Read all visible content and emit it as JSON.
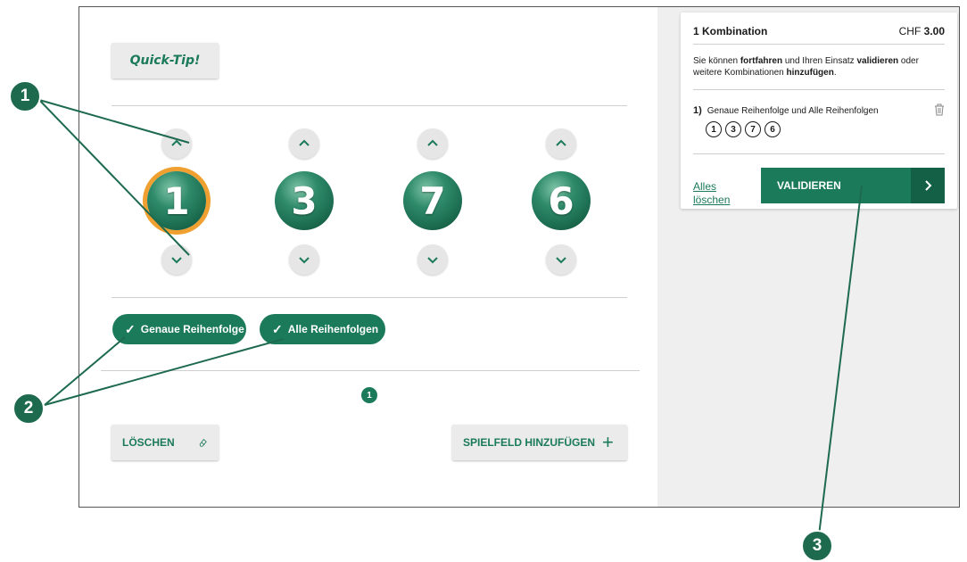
{
  "quick_tip": {
    "label": "Quick-Tip!"
  },
  "balls": [
    {
      "number": "1",
      "selected": true
    },
    {
      "number": "3",
      "selected": false
    },
    {
      "number": "7",
      "selected": false
    },
    {
      "number": "6",
      "selected": false
    }
  ],
  "options": [
    {
      "label": "Genaue Reihenfolge"
    },
    {
      "label": "Alle Reihenfolgen"
    }
  ],
  "pagination": {
    "current": "1"
  },
  "actions": {
    "delete_label": "LÖSCHEN",
    "add_field_label": "SPIELFELD HINZUFÜGEN"
  },
  "summary": {
    "title": "1 Kombination",
    "currency": "CHF",
    "amount": "3.00",
    "msg_1": "Sie können ",
    "msg_b1": "fortfahren",
    "msg_2": " und Ihren Einsatz ",
    "msg_b2": "validieren",
    "msg_3": " oder weitere Kombinationen ",
    "msg_b3": "hinzufügen",
    "msg_4": ".",
    "combo_index": "1)",
    "combo_label": "Genaue Reihenfolge und Alle Reihenfolgen",
    "combo_numbers": [
      "1",
      "3",
      "7",
      "6"
    ],
    "clear_all": "Alles löschen",
    "validate_label": "VALIDIEREN"
  },
  "annotations": [
    {
      "label": "1"
    },
    {
      "label": "2"
    },
    {
      "label": "3"
    }
  ],
  "colors": {
    "brand_green": "#1b7a5a",
    "selection_ring": "#f0a030"
  }
}
